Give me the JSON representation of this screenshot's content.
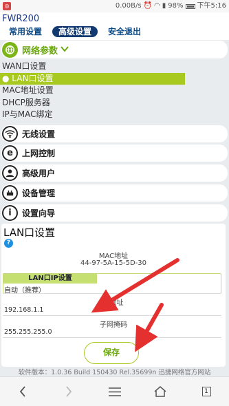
{
  "statusbar": {
    "app_icon": "app-icon",
    "net_speed": "0.00B/s",
    "battery": "98%",
    "time": "下午5:16"
  },
  "header": {
    "brand": "FWR200",
    "tabs": [
      "常用设置",
      "高级设置",
      "安全退出"
    ],
    "active_tab": 1
  },
  "sidebar": {
    "network_section": {
      "label": "网络参数",
      "icon": "globe-icon"
    },
    "sub_items": [
      "WAN口设置",
      "LAN口设置",
      "MAC地址设置",
      "DHCP服务器",
      "IP与MAC绑定"
    ],
    "active_sub": 1,
    "sections": [
      {
        "label": "无线设置",
        "icon": "wifi-icon"
      },
      {
        "label": "上网控制",
        "icon": "e-icon"
      },
      {
        "label": "高级用户",
        "icon": "user-icon"
      },
      {
        "label": "设备管理",
        "icon": "gear-icon"
      },
      {
        "label": "设置向导",
        "icon": "info-icon"
      }
    ]
  },
  "panel": {
    "title": "LAN口设置",
    "help": "?",
    "mac_label": "MAC地址",
    "mac_value": "44-97-5A-15-5D-30",
    "ip_settings_label": "LAN口IP设置",
    "ip_mode": "自动（推荐）",
    "ip_label": "IP地址",
    "ip_value": "192.168.1.1",
    "mask_label": "子网掩码",
    "mask_value": "255.255.255.0",
    "save_label": "保存"
  },
  "footer": {
    "version_text": "软件版本：1.0.36 Build 150430 Rel.35699n   迅捷网络官方网站"
  },
  "bottombar": {
    "tab_count": "1"
  },
  "colors": {
    "accent_green": "#a8c920",
    "nav_active": "#123a70",
    "arrow_red": "#e53030"
  }
}
